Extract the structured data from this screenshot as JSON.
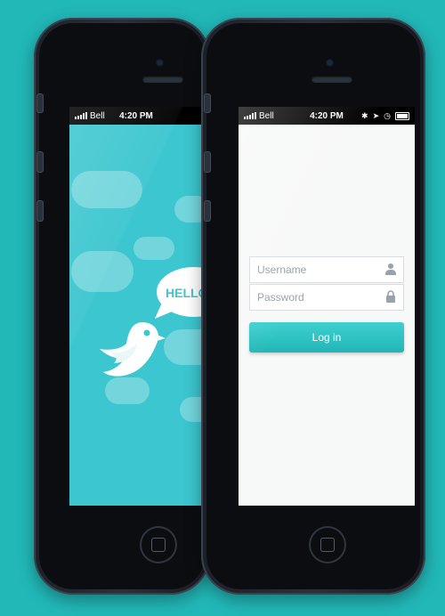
{
  "phones": {
    "left": {
      "status_bar": {
        "carrier": "Bell",
        "time": "4:20 PM"
      },
      "splash": {
        "speech_bubble": "HELLO",
        "bird_icon": "bird-icon",
        "background_color": "#3cc6cf"
      }
    },
    "right": {
      "status_bar": {
        "carrier": "Bell",
        "time": "4:20 PM",
        "icons": [
          "bluetooth-icon",
          "location-icon",
          "alarm-icon",
          "battery-icon"
        ]
      },
      "login_form": {
        "username_placeholder": "Username",
        "password_placeholder": "Password",
        "username_icon": "user-icon",
        "password_icon": "lock-icon",
        "login_label": "Log in",
        "accent_color": "#2ec0c0"
      }
    }
  }
}
